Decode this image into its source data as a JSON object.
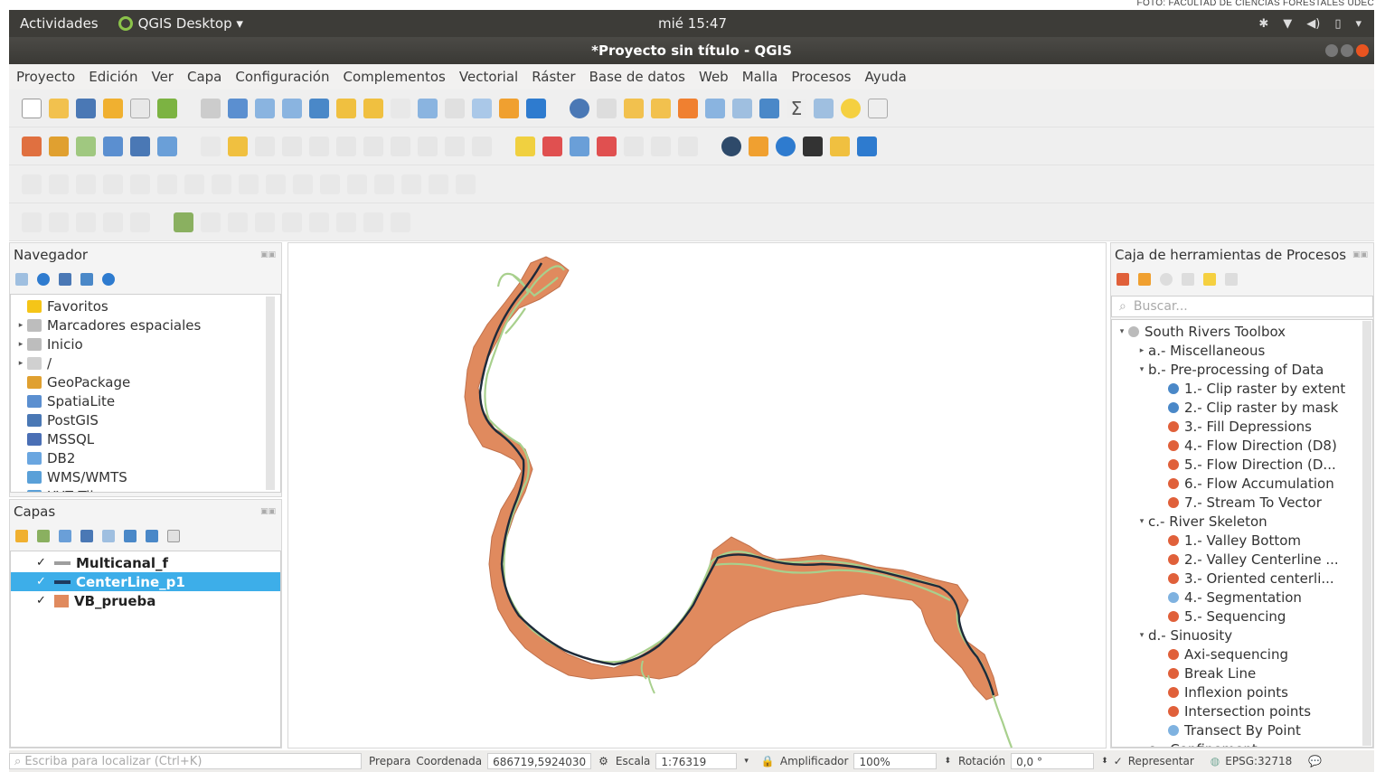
{
  "credit": "FOTO: FACULTAD DE CIENCIAS FORESTALES UDEC",
  "topbar": {
    "activities": "Actividades",
    "app_name": "QGIS Desktop ▾",
    "clock": "mié 15:47"
  },
  "window": {
    "title": "*Proyecto sin título - QGIS"
  },
  "menu": [
    "Proyecto",
    "Edición",
    "Ver",
    "Capa",
    "Configuración",
    "Complementos",
    "Vectorial",
    "Ráster",
    "Base de datos",
    "Web",
    "Malla",
    "Procesos",
    "Ayuda"
  ],
  "browser": {
    "title": "Navegador",
    "items": [
      {
        "label": "Favoritos",
        "icon": "star-icon",
        "color": "#f5c518",
        "arrow": ""
      },
      {
        "label": "Marcadores espaciales",
        "icon": "bookmark-icon",
        "color": "#bdbdbd",
        "arrow": "▸"
      },
      {
        "label": "Inicio",
        "icon": "home-icon",
        "color": "#bdbdbd",
        "arrow": "▸"
      },
      {
        "label": "/",
        "icon": "folder-icon",
        "color": "#d0d0d0",
        "arrow": "▸"
      },
      {
        "label": "GeoPackage",
        "icon": "geopackage-icon",
        "color": "#e0a030",
        "arrow": ""
      },
      {
        "label": "SpatiaLite",
        "icon": "spatialite-icon",
        "color": "#5b8fd0",
        "arrow": ""
      },
      {
        "label": "PostGIS",
        "icon": "postgis-icon",
        "color": "#4a78b5",
        "arrow": ""
      },
      {
        "label": "MSSQL",
        "icon": "mssql-icon",
        "color": "#4a6fb5",
        "arrow": ""
      },
      {
        "label": "DB2",
        "icon": "db2-icon",
        "color": "#6aa6e0",
        "arrow": ""
      },
      {
        "label": "WMS/WMTS",
        "icon": "wms-icon",
        "color": "#5aa0d8",
        "arrow": ""
      },
      {
        "label": "XYZ Tiles",
        "icon": "xyz-icon",
        "color": "#5aa0d8",
        "arrow": "▸"
      }
    ]
  },
  "layers": {
    "title": "Capas",
    "items": [
      {
        "name": "Multicanal_f",
        "symbol": "#9e9e9e",
        "selected": false
      },
      {
        "name": "CenterLine_p1",
        "symbol": "#1e3a5f",
        "selected": true
      },
      {
        "name": "VB_prueba",
        "symbol": "#e08a5e",
        "selected": false
      }
    ]
  },
  "processing": {
    "title": "Caja de herramientas de Procesos",
    "search_placeholder": "Buscar...",
    "tree": [
      {
        "label": "South Rivers Toolbox",
        "level": 0,
        "arrow": "▾",
        "icon": "toolbox-icon",
        "color": "#bbbbbb"
      },
      {
        "label": "a.- Miscellaneous",
        "level": 1,
        "arrow": "▸",
        "icon": "",
        "color": ""
      },
      {
        "label": "b.- Pre-processing of Data",
        "level": 1,
        "arrow": "▾",
        "icon": "",
        "color": ""
      },
      {
        "label": "1.- Clip raster by extent",
        "level": 2,
        "arrow": "",
        "icon": "raster-icon",
        "color": "#4a88c8"
      },
      {
        "label": "2.- Clip raster by mask",
        "level": 2,
        "arrow": "",
        "icon": "raster-icon",
        "color": "#4a88c8"
      },
      {
        "label": "3.- Fill Depressions",
        "level": 2,
        "arrow": "",
        "icon": "algorithm-icon",
        "color": "#e0603a"
      },
      {
        "label": "4.- Flow Direction (D8)",
        "level": 2,
        "arrow": "",
        "icon": "algorithm-icon",
        "color": "#e0603a"
      },
      {
        "label": "5.- Flow Direction (D...",
        "level": 2,
        "arrow": "",
        "icon": "algorithm-icon",
        "color": "#e0603a"
      },
      {
        "label": "6.- Flow Accumulation",
        "level": 2,
        "arrow": "",
        "icon": "algorithm-icon",
        "color": "#e0603a"
      },
      {
        "label": "7.- Stream To Vector",
        "level": 2,
        "arrow": "",
        "icon": "algorithm-icon",
        "color": "#e0603a"
      },
      {
        "label": "c.- River Skeleton",
        "level": 1,
        "arrow": "▾",
        "icon": "",
        "color": ""
      },
      {
        "label": "1.- Valley Bottom",
        "level": 2,
        "arrow": "",
        "icon": "algorithm-icon",
        "color": "#e0603a"
      },
      {
        "label": "2.- Valley Centerline ...",
        "level": 2,
        "arrow": "",
        "icon": "algorithm-icon",
        "color": "#e0603a"
      },
      {
        "label": "3.- Oriented centerli...",
        "level": 2,
        "arrow": "",
        "icon": "algorithm-icon",
        "color": "#e0603a"
      },
      {
        "label": "4.- Segmentation",
        "level": 2,
        "arrow": "",
        "icon": "gear-icon",
        "color": "#7fb2e0"
      },
      {
        "label": "5.- Sequencing",
        "level": 2,
        "arrow": "",
        "icon": "algorithm-icon",
        "color": "#e0603a"
      },
      {
        "label": "d.- Sinuosity",
        "level": 1,
        "arrow": "▾",
        "icon": "",
        "color": ""
      },
      {
        "label": "Axi-sequencing",
        "level": 2,
        "arrow": "",
        "icon": "algorithm-icon",
        "color": "#e0603a"
      },
      {
        "label": "Break Line",
        "level": 2,
        "arrow": "",
        "icon": "algorithm-icon",
        "color": "#e0603a"
      },
      {
        "label": "Inflexion points",
        "level": 2,
        "arrow": "",
        "icon": "algorithm-icon",
        "color": "#e0603a"
      },
      {
        "label": "Intersection points",
        "level": 2,
        "arrow": "",
        "icon": "algorithm-icon",
        "color": "#e0603a"
      },
      {
        "label": "Transect By Point",
        "level": 2,
        "arrow": "",
        "icon": "gear-icon",
        "color": "#7fb2e0"
      },
      {
        "label": "e.- Confinement",
        "level": 1,
        "arrow": "▸",
        "icon": "",
        "color": ""
      }
    ]
  },
  "status": {
    "locate_placeholder": "Escriba para localizar (Ctrl+K)",
    "message": "Prepara",
    "coord_label": "Coordenada",
    "coord_value": "686719,5924030",
    "scale_label": "Escala",
    "scale_value": "1:76319",
    "magnifier_label": "Amplificador",
    "magnifier_value": "100%",
    "rotation_label": "Rotación",
    "rotation_value": "0,0 °",
    "render_label": "Representar",
    "crs": "EPSG:32718"
  },
  "map_colors": {
    "valley": "#e08a5e",
    "multichannel": "#a8d08d",
    "centerline": "#1e2a3a"
  }
}
